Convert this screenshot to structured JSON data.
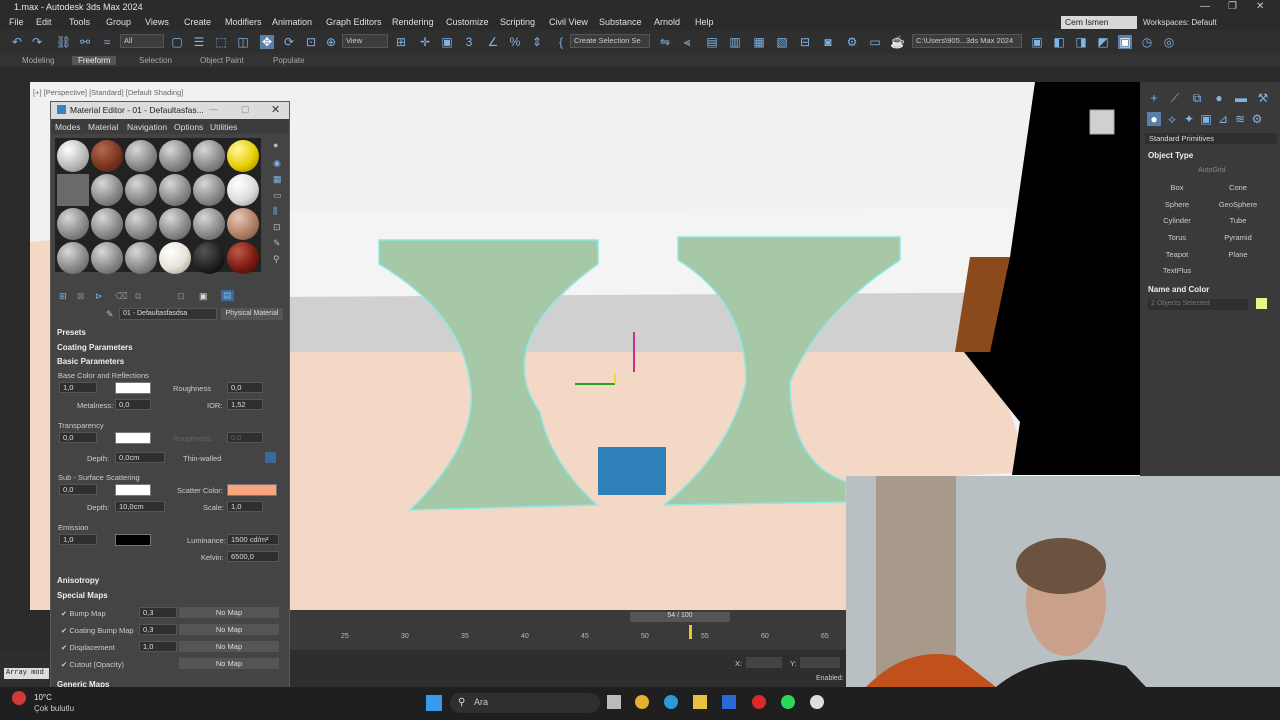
{
  "window": {
    "title": "1.max - Autodesk 3ds Max 2024",
    "controls": [
      "—",
      "❐",
      "✕"
    ]
  },
  "menu": [
    "File",
    "Edit",
    "Tools",
    "Group",
    "Views",
    "Create",
    "Modifiers",
    "Animation",
    "Graph Editors",
    "Rendering",
    "Customize",
    "Scripting",
    "Civil View",
    "Substance",
    "Arnold",
    "Help"
  ],
  "user": {
    "name": "Cem Ismen",
    "workspace": "Workspaces: Default"
  },
  "toolbar": {
    "filter": "All",
    "view": "View",
    "selection_set": "Create Selection Se",
    "path": "C:\\Users\\905...3ds Max 2024"
  },
  "ribbon": {
    "tabs": [
      "Modeling",
      "Freeform",
      "Selection",
      "Object Paint",
      "Populate"
    ],
    "active": "Freeform"
  },
  "viewport": {
    "label": "[+] [Perspective] [Standard] [Default Shading]"
  },
  "command_panel": {
    "category": "Standard Primitives",
    "object_type": "Object Type",
    "autogrid": "AutoGrid",
    "buttons": [
      "Box",
      "Cone",
      "Sphere",
      "GeoSphere",
      "Cylinder",
      "Tube",
      "Torus",
      "Pyramid",
      "Teapot",
      "Plane",
      "TextPlus"
    ],
    "name_and_color": "Name and Color",
    "selected": "2 Objects Selected"
  },
  "material_editor": {
    "title": "Material Editor - 01 - Defaultasfas...",
    "menu": [
      "Modes",
      "Material",
      "Navigation",
      "Options",
      "Utilities"
    ],
    "material_name": "01 - Defaultasfasdsa",
    "material_type": "Physical Material",
    "sections": {
      "presets": "Presets",
      "coating": "Coating Parameters",
      "basic": "Basic Parameters",
      "anisotropy": "Anisotropy",
      "special_maps": "Special Maps",
      "generic_maps": "Generic Maps"
    },
    "base": {
      "label": "Base Color and Reflections",
      "weight": "1,0",
      "roughness_label": "Roughness",
      "roughness": "0,0",
      "metalness_label": "Metalness:",
      "metalness": "0,0",
      "ior_label": "IOR:",
      "ior": "1,52"
    },
    "transparency": {
      "label": "Transparency",
      "weight": "0,0",
      "roughness_label": "Roughness",
      "roughness": "0,0",
      "depth_label": "Depth:",
      "depth": "0,0cm",
      "thin_walled": "Thin-walled"
    },
    "sss": {
      "label": "Sub - Surface Scattering",
      "weight": "0,0",
      "scatter_label": "Scatter Color:",
      "scatter_color": "#f8a57e",
      "depth_label": "Depth:",
      "depth": "10,0cm",
      "scale_label": "Scale:",
      "scale": "1,0"
    },
    "emission": {
      "label": "Emission",
      "weight": "1,0",
      "luminance_label": "Luminance:",
      "luminance": "1500 cd/m²",
      "kelvin_label": "Kelvin:",
      "kelvin": "6500,0"
    },
    "maps": [
      {
        "name": "Bump Map",
        "value": "0,3",
        "map": "No Map"
      },
      {
        "name": "Coating Bump Map",
        "value": "0,3",
        "map": "No Map"
      },
      {
        "name": "Displacement",
        "value": "1,0",
        "map": "No Map"
      },
      {
        "name": "Cutout (Opacity)",
        "value": "",
        "map": "No Map"
      }
    ]
  },
  "timeline": {
    "frame": "54 / 100",
    "ticks": [
      "25",
      "30",
      "35",
      "40",
      "45",
      "50",
      "55",
      "60",
      "65"
    ],
    "progress": 0.54
  },
  "status": {
    "x_label": "X:",
    "y_label": "Y:",
    "enabled": "Enabled:",
    "maxscript": "Array mod"
  },
  "taskbar": {
    "weather_temp": "10°C",
    "weather_desc": "Çok bulutlu",
    "search": "Ara"
  }
}
